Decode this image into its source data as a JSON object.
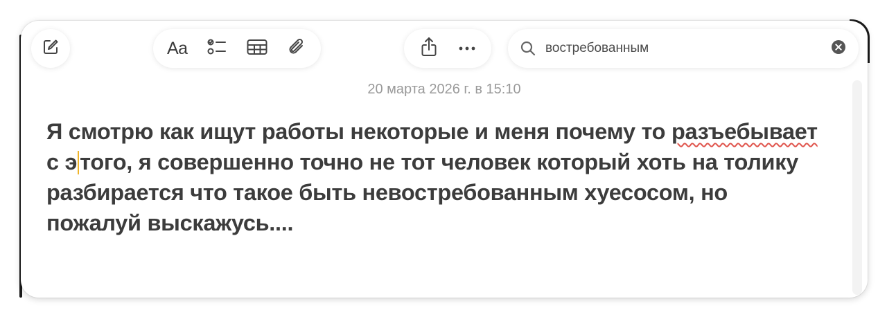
{
  "toolbar": {
    "compose_icon": "square-pencil-icon",
    "format_label": "Aa",
    "checklist_icon": "checklist-icon",
    "table_icon": "table-icon",
    "attachment_icon": "paperclip-icon",
    "share_icon": "share-icon",
    "more_icon": "ellipsis-icon"
  },
  "search": {
    "value": "востребованным",
    "icon": "magnifying-glass-icon",
    "clear_icon": "clear-circle-icon"
  },
  "note": {
    "date": "20 марта 2026 г. в 15:10",
    "text_part1": "Я смотрю как ищут работы некоторые и меня почему то ",
    "misspelled_word": "разъебывает",
    "text_part2": " с э",
    "text_part3": "того, я совершенно точно не тот человек который хоть на толику разбирается что такое быть невостребованным хуесосом, но пожалуй выскажусь...."
  },
  "colors": {
    "text": "#3c3c3c",
    "date": "#9a9a9a",
    "caret": "#f0b429",
    "spellcheck": "#e0554d"
  }
}
